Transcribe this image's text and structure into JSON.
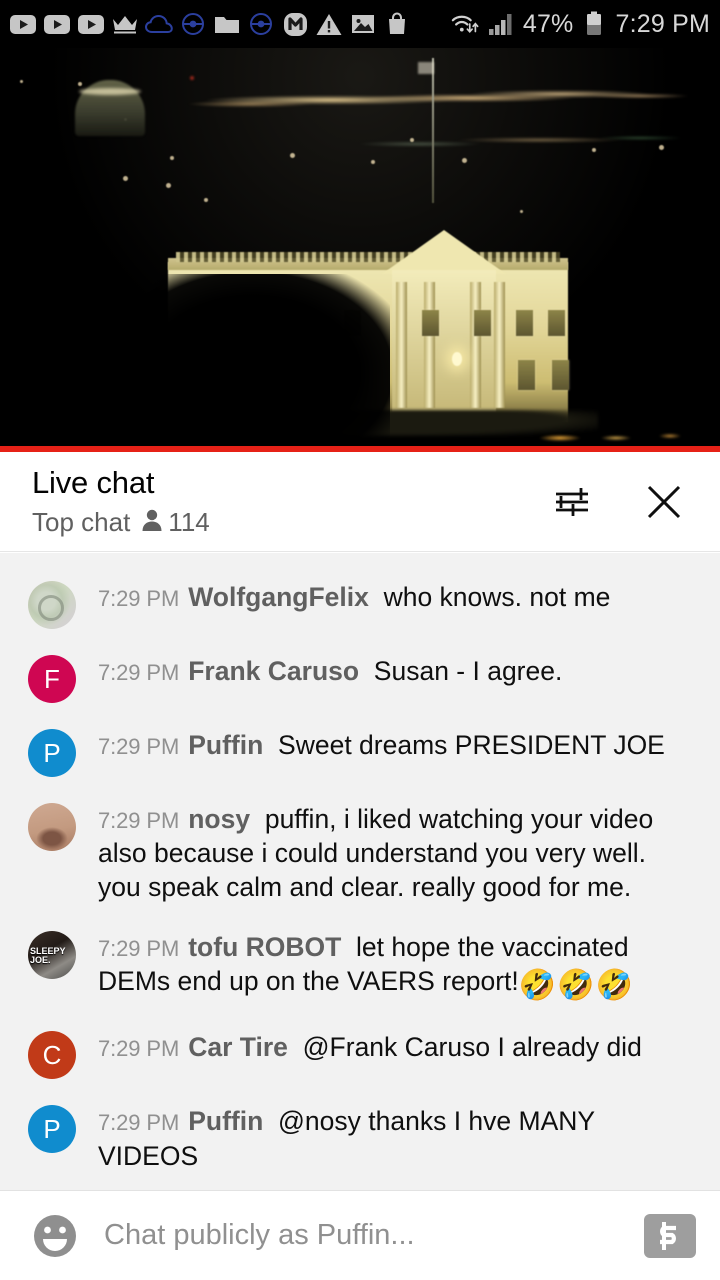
{
  "status_bar": {
    "left_icons": [
      {
        "name": "youtube-icon"
      },
      {
        "name": "youtube-icon"
      },
      {
        "name": "youtube-icon"
      },
      {
        "name": "crown-icon"
      },
      {
        "name": "cloud-icon"
      },
      {
        "name": "pokeball-icon"
      },
      {
        "name": "folder-icon"
      },
      {
        "name": "pokeball-icon"
      },
      {
        "name": "m-badge-icon"
      },
      {
        "name": "warning-triangle-icon"
      },
      {
        "name": "image-icon"
      },
      {
        "name": "shopping-bag-icon"
      }
    ],
    "wifi_icon": "wifi-icon",
    "signal_icon": "cellular-signal-icon",
    "battery_percent": "47%",
    "battery_icon": "battery-icon",
    "clock": "7:29 PM"
  },
  "video": {
    "name": "live-video-player",
    "description": "White House at night live stream",
    "progress_color": "#e62117"
  },
  "chat_header": {
    "title": "Live chat",
    "mode": "Top chat",
    "viewer_count": "114",
    "viewers_icon": "person-icon",
    "settings_icon": "chat-settings-icon",
    "close_icon": "close-icon"
  },
  "messages": [
    {
      "timestamp": "7:29 PM",
      "author": "WolfgangFelix",
      "text": "who knows. not me",
      "avatar_type": "photo",
      "avatar_class": "av-photo-1",
      "avatar_letter": "",
      "avatar_color": "#d6d3c6"
    },
    {
      "timestamp": "7:29 PM",
      "author": "Frank Caruso",
      "text": "Susan - I agree.",
      "avatar_type": "letter",
      "avatar_class": "",
      "avatar_letter": "F",
      "avatar_color": "#cf0652"
    },
    {
      "timestamp": "7:29 PM",
      "author": "Puffin",
      "text": "Sweet dreams PRESIDENT JOE",
      "avatar_type": "letter",
      "avatar_class": "",
      "avatar_letter": "P",
      "avatar_color": "#108cce"
    },
    {
      "timestamp": "7:29 PM",
      "author": "nosy",
      "text": "puffin, i liked watching your video also because i could understand you very well. you speak calm and clear. really good for me.",
      "avatar_type": "photo",
      "avatar_class": "av-photo-2",
      "avatar_letter": "",
      "avatar_color": "#c39a80"
    },
    {
      "timestamp": "7:29 PM",
      "author": "tofu ROBOT",
      "text": "let hope the vaccinated DEMs end up on the VAERS report!",
      "emoji": "🤣🤣🤣",
      "avatar_type": "photo",
      "avatar_class": "av-photo-3",
      "avatar_overlay": "SLEEPY JOE.",
      "avatar_letter": "",
      "avatar_color": "#3b2f28"
    },
    {
      "timestamp": "7:29 PM",
      "author": "Car Tire",
      "text": "@Frank Caruso I already did",
      "avatar_type": "letter",
      "avatar_class": "",
      "avatar_letter": "C",
      "avatar_color": "#c13a18"
    },
    {
      "timestamp": "7:29 PM",
      "author": "Puffin",
      "text": "@nosy thanks I hve MANY VIDEOS",
      "avatar_type": "letter",
      "avatar_class": "",
      "avatar_letter": "P",
      "avatar_color": "#108cce"
    }
  ],
  "composer": {
    "emoji_icon": "emoji-face-icon",
    "placeholder": "Chat publicly as Puffin...",
    "value": "",
    "super_chat_icon": "dollar-bill-icon"
  }
}
